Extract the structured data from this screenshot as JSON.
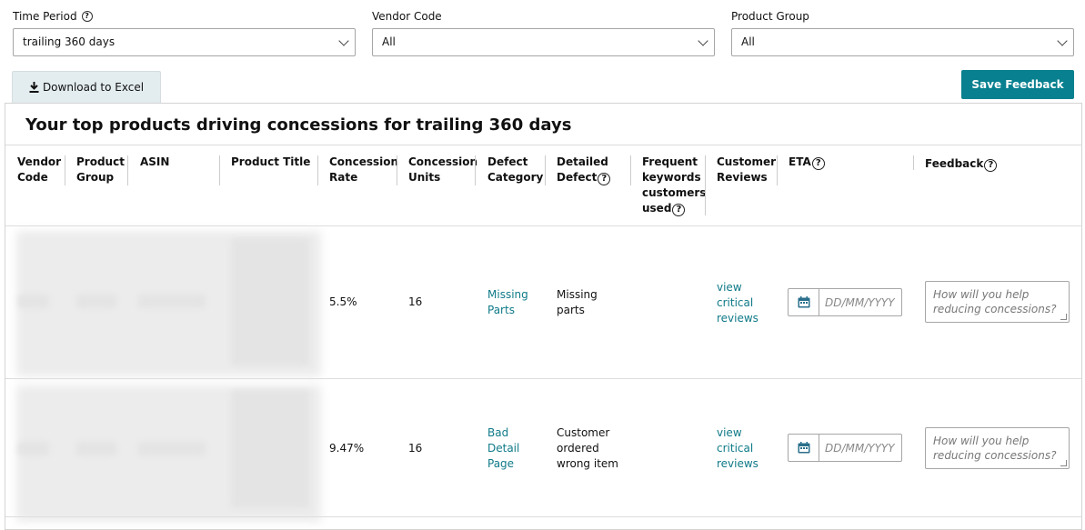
{
  "filters": {
    "time_period": {
      "label": "Time Period",
      "value": "trailing 360 days"
    },
    "vendor_code": {
      "label": "Vendor Code",
      "value": "All"
    },
    "product_group": {
      "label": "Product Group",
      "value": "All"
    }
  },
  "toolbar": {
    "download_label": "Download to Excel",
    "save_label": "Save Feedback"
  },
  "table": {
    "title": "Your top products driving concessions for trailing 360 days",
    "columns": {
      "vendor_code": "Vendor Code",
      "product_group": "Product Group",
      "asin": "ASIN",
      "product_title": "Product Title",
      "concession_rate": "Concession Rate",
      "concession_units": "Concession Units",
      "defect_category": "Defect Category",
      "detailed_defect": "Detailed Defect",
      "keywords": "Frequent keywords customers used",
      "reviews": "Customer Reviews",
      "eta": "ETA",
      "feedback": "Feedback"
    },
    "rows": [
      {
        "concession_rate": "5.5%",
        "concession_units": "16",
        "defect_category": "Missing Parts",
        "detailed_defect": "Missing parts",
        "reviews_link": "view critical reviews",
        "eta_placeholder": "DD/MM/YYYY",
        "feedback_placeholder": "How will you help reducing concessions?"
      },
      {
        "concession_rate": "9.47%",
        "concession_units": "16",
        "defect_category": "Bad Detail Page",
        "detailed_defect": "Customer ordered wrong item",
        "reviews_link": "view critical reviews",
        "eta_placeholder": "DD/MM/YYYY",
        "feedback_placeholder": "How will you help reducing concessions?"
      }
    ]
  },
  "icons": {
    "help": "question-circle-icon",
    "calendar": "calendar-icon",
    "download": "download-icon",
    "chevron": "chevron-down-icon"
  },
  "colors": {
    "accent": "#08808f",
    "link": "#0f7a88",
    "download_bg": "#e3ecef"
  }
}
